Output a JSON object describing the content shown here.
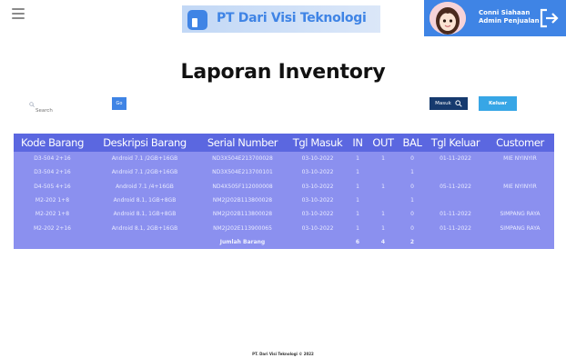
{
  "header": {
    "brand_name": "PT Dari Visi Teknologi",
    "user_name": "Conni Siahaan",
    "user_role": "Admin Penjualan",
    "accent_color": "#3f84e5"
  },
  "page": {
    "title": "Laporan Inventory"
  },
  "controls": {
    "search_placeholder": "Search",
    "go_label": "Go",
    "masuk_label": "Masuk",
    "keluar_label": "Keluar"
  },
  "table": {
    "columns": [
      "Kode Barang",
      "Deskripsi Barang",
      "Serial Number",
      "Tgl Masuk",
      "IN",
      "OUT",
      "BAL",
      "Tgl Keluar",
      "Customer"
    ],
    "rows": [
      [
        "D3-504 2+16",
        "Android 7.1 /2GB+16GB",
        "ND3X504E213700028",
        "03-10-2022",
        "1",
        "1",
        "0",
        "01-11-2022",
        "MIE NYINYIR"
      ],
      [
        "D3-504 2+16",
        "Android 7.1 /2GB+16GB",
        "ND3X504E213700101",
        "03-10-2022",
        "1",
        "",
        "1",
        "",
        ""
      ],
      [
        "D4-505 4+16",
        "Android 7.1 /4+16GB",
        "ND4X505F112000008",
        "03-10-2022",
        "1",
        "1",
        "0",
        "05-11-2022",
        "MIE NYINYIR"
      ],
      [
        "M2-202 1+8",
        "Android 8.1, 1GB+8GB",
        "NM2J202B113800028",
        "03-10-2022",
        "1",
        "",
        "1",
        "",
        ""
      ],
      [
        "M2-202 1+8",
        "Android 8.1, 1GB+8GB",
        "NM2J202B113800028",
        "03-10-2022",
        "1",
        "1",
        "0",
        "01-11-2022",
        "SIMPANG RAYA"
      ],
      [
        "M2-202 2+16",
        "Android 8.1, 2GB+16GB",
        "NM2J202E113900065",
        "03-10-2022",
        "1",
        "1",
        "0",
        "01-11-2022",
        "SIMPANG RAYA"
      ]
    ],
    "total_label": "Jumlah Barang",
    "total_in": "6",
    "total_out": "4",
    "total_bal": "2"
  },
  "footer": {
    "text": "PT. Dari Visi Teknologi © 2022"
  }
}
